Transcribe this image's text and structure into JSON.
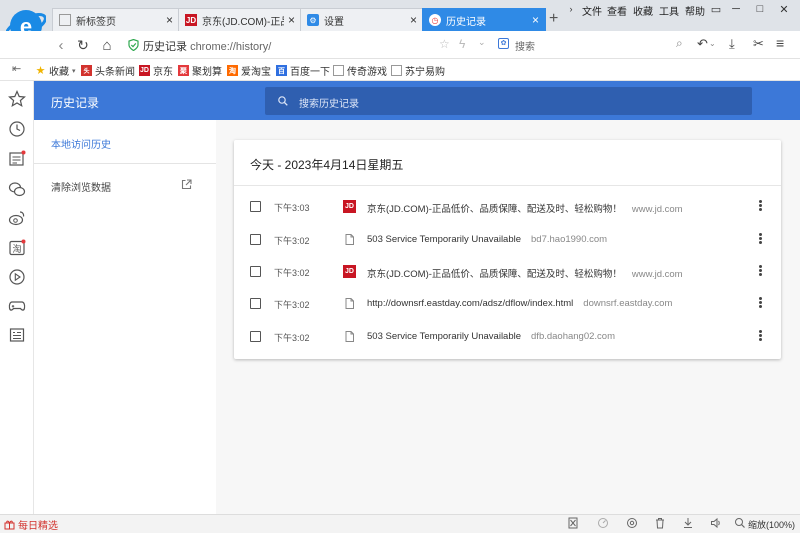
{
  "tabs": [
    {
      "label": "新标签页",
      "icon": "grid-icon",
      "active": false
    },
    {
      "label": "京东(JD.COM)-正品低",
      "icon": "jd-icon",
      "active": false
    },
    {
      "label": "设置",
      "icon": "gear-icon",
      "active": false
    },
    {
      "label": "历史记录",
      "icon": "clock-icon",
      "active": true
    }
  ],
  "menu": {
    "file": "文件",
    "view": "查看",
    "favorites": "收藏",
    "tools": "工具",
    "help": "帮助"
  },
  "address": {
    "title": "历史记录",
    "url": "chrome://history/"
  },
  "top_search": {
    "placeholder": "搜索"
  },
  "bookmarks": [
    {
      "label": "收藏",
      "icon": "star-icon",
      "color": "#f0b400"
    },
    {
      "label": "头条新闻",
      "icon": "toutiao-icon",
      "color": "#d2322d"
    },
    {
      "label": "京东",
      "icon": "jd-icon",
      "color": "#c81623"
    },
    {
      "label": "聚划算",
      "icon": "juhuasuan-icon",
      "color": "#e4393c"
    },
    {
      "label": "爱淘宝",
      "icon": "taobao-icon",
      "color": "#ff6a00"
    },
    {
      "label": "百度一下",
      "icon": "baidu-icon",
      "color": "#2f6fe0"
    },
    {
      "label": "传奇游戏",
      "icon": "page-icon",
      "color": "#999999"
    },
    {
      "label": "苏宁易购",
      "icon": "page-icon",
      "color": "#999999"
    }
  ],
  "history": {
    "title": "历史记录",
    "search_placeholder": "搜索历史记录",
    "nav_local": "本地访问历史",
    "nav_clear": "清除浏览数据",
    "day_title": "今天 - 2023年4月14日星期五",
    "rows": [
      {
        "time": "下午3:03",
        "title": "京东(JD.COM)-正品低价、品质保障、配送及时、轻松购物！",
        "domain": "www.jd.com",
        "icon": "jd-icon"
      },
      {
        "time": "下午3:02",
        "title": "503 Service Temporarily Unavailable",
        "domain": "bd7.hao1990.com",
        "icon": "page-icon"
      },
      {
        "time": "下午3:02",
        "title": "京东(JD.COM)-正品低价、品质保障、配送及时、轻松购物！",
        "domain": "www.jd.com",
        "icon": "jd-icon"
      },
      {
        "time": "下午3:02",
        "title": "http://downsrf.eastday.com/adsz/dflow/index.html",
        "domain": "downsrf.eastday.com",
        "icon": "page-icon"
      },
      {
        "time": "下午3:02",
        "title": "503 Service Temporarily Unavailable",
        "domain": "dfb.daohang02.com",
        "icon": "page-icon"
      }
    ]
  },
  "status": {
    "daily": "每日精选",
    "zoom": "缩放(100%)"
  },
  "colors": {
    "accent": "#3c78d8",
    "tab_active": "#2f8ae6",
    "jd_red": "#c81623"
  }
}
